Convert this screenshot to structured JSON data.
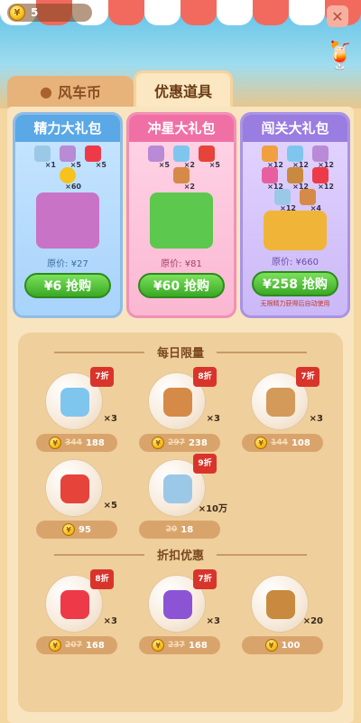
{
  "header": {
    "coins": "5",
    "close_label": "✕"
  },
  "tabs": [
    {
      "label": "风车币"
    },
    {
      "label": "优惠道具"
    }
  ],
  "bundles": [
    {
      "title": "精力大礼包",
      "items": [
        {
          "icon": "energy-drop-icon",
          "count": "×1"
        },
        {
          "icon": "flower-icon",
          "count": "×5"
        },
        {
          "icon": "plus-five-icon",
          "count": "×5"
        },
        {
          "icon": "coin-icon",
          "count": "×60"
        }
      ],
      "original_price": "原价: ¥27",
      "buy_label": "¥6 抢购"
    },
    {
      "title": "冲星大礼包",
      "items": [
        {
          "icon": "butterfly-icon",
          "count": "×5"
        },
        {
          "icon": "shoe-icon",
          "count": "×2"
        },
        {
          "icon": "grid-box-icon",
          "count": "×5"
        },
        {
          "icon": "bear-icon",
          "count": "×2"
        }
      ],
      "original_price": "原价: ¥81",
      "buy_label": "¥60 抢购"
    },
    {
      "title": "闯关大礼包",
      "items": [
        {
          "icon": "fruit-icon",
          "count": "×12"
        },
        {
          "icon": "shoe-icon",
          "count": "×12"
        },
        {
          "icon": "butterfly-icon",
          "count": "×12"
        },
        {
          "icon": "candy-icon",
          "count": "×12"
        },
        {
          "icon": "basket-icon",
          "count": "×12"
        },
        {
          "icon": "plus-five-icon",
          "count": "×12"
        },
        {
          "icon": "energy-drop-icon",
          "count": "×12"
        },
        {
          "icon": "bear-icon",
          "count": "×4"
        }
      ],
      "original_price": "原价: ¥660",
      "buy_label": "¥258 抢购",
      "note": "无限精力获得后自动使用"
    }
  ],
  "daily": {
    "title": "每日限量",
    "items": [
      {
        "icon": "shoe-icon",
        "discount": "7折",
        "qty": "×3",
        "old_price": "344",
        "price": "188",
        "color": "#7fc6ef"
      },
      {
        "icon": "bear-icon",
        "discount": "8折",
        "qty": "×3",
        "old_price": "297",
        "price": "238",
        "color": "#d68a47"
      },
      {
        "icon": "hammer-icon",
        "discount": "7折",
        "qty": "×3",
        "old_price": "144",
        "price": "108",
        "color": "#d39a5a"
      },
      {
        "icon": "grid-box-icon",
        "discount": "",
        "qty": "×5",
        "old_price": "",
        "price": "95",
        "color": "#e6433a"
      },
      {
        "icon": "energy-drop-icon",
        "discount": "9折",
        "qty": "×10万",
        "old_price": "20",
        "price": "18",
        "color": "#9cc8e8"
      }
    ]
  },
  "discount": {
    "title": "折扣优惠",
    "items": [
      {
        "icon": "plus-five-icon",
        "discount": "8折",
        "qty": "×3",
        "old_price": "207",
        "price": "168",
        "color": "#ee3a48"
      },
      {
        "icon": "bird-icon",
        "discount": "7折",
        "qty": "×3",
        "old_price": "237",
        "price": "168",
        "color": "#8c54d4"
      },
      {
        "icon": "hourglass-icon",
        "discount": "",
        "qty": "×20",
        "old_price": "",
        "price": "100",
        "color": "#c98a3f"
      }
    ]
  }
}
